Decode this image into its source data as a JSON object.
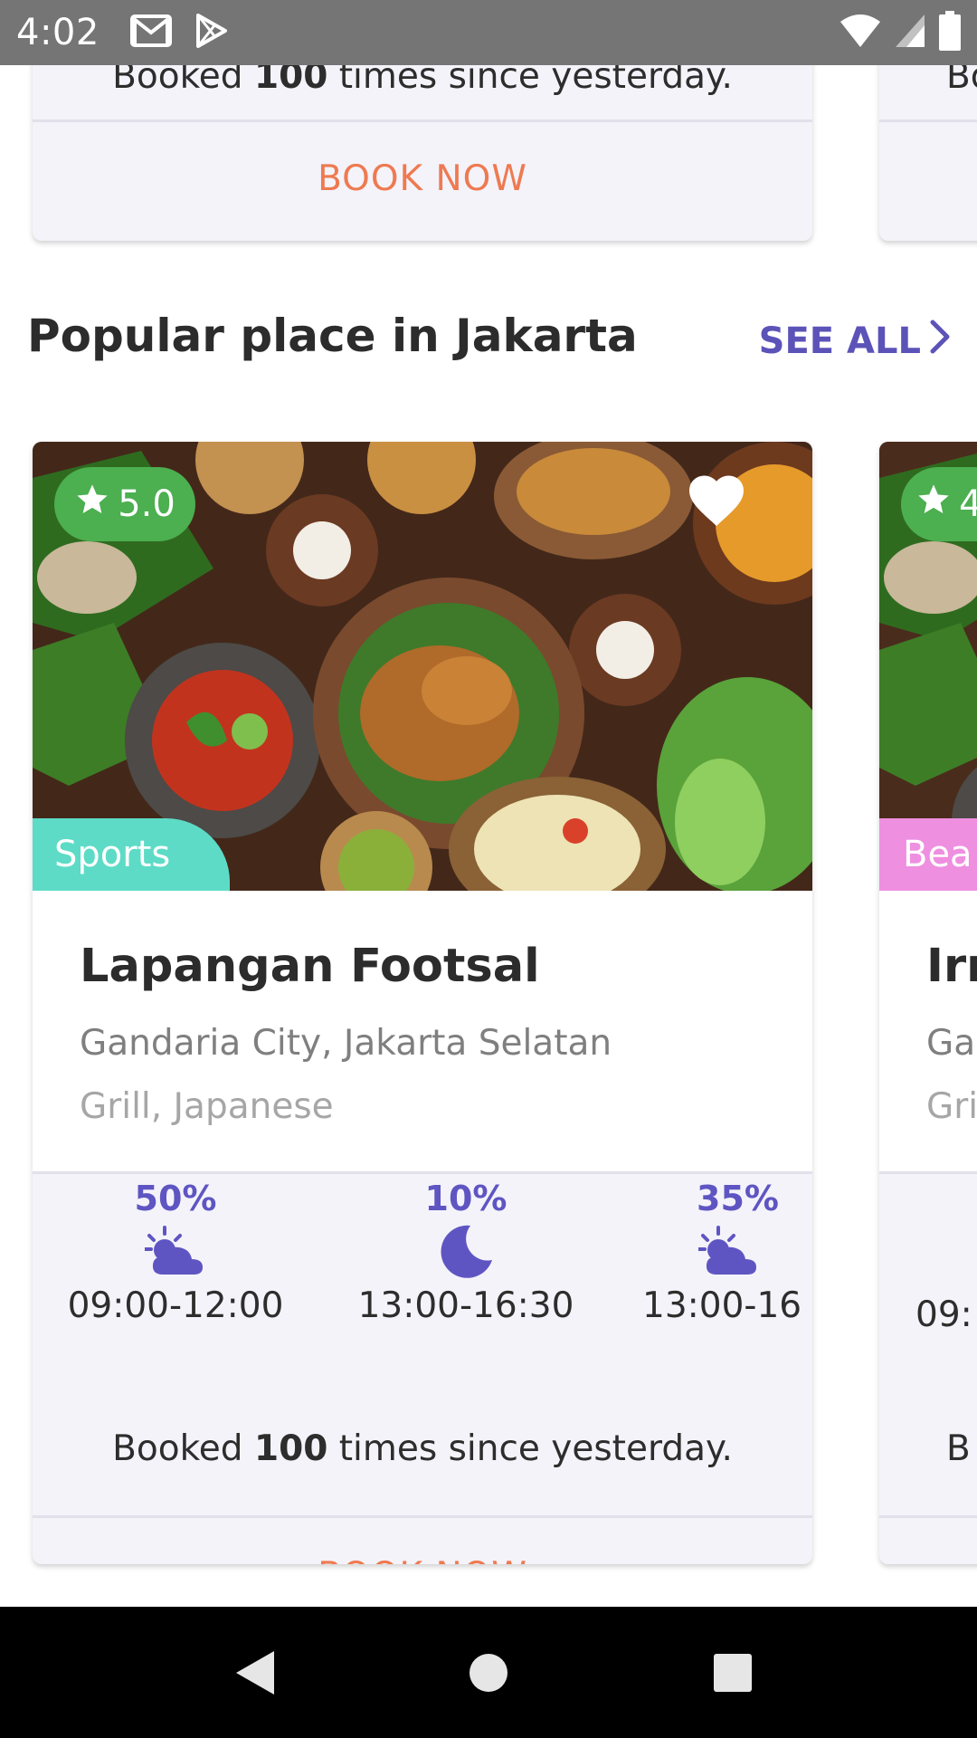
{
  "status_bar": {
    "time": "4:02"
  },
  "top_card": {
    "booked_prefix": "Booked ",
    "booked_count": "100",
    "booked_suffix": " times since yesterday.",
    "book_now": "BOOK NOW",
    "peek_text": "Bo"
  },
  "section": {
    "title": "Popular place in Jakarta",
    "see_all": "SEE ALL"
  },
  "place_card": {
    "rating": "5.0",
    "category": "Sports",
    "name": "Lapangan Footsal",
    "location": "Gandaria City, Jakarta Selatan",
    "cuisine": "Grill, Japanese",
    "slots": [
      {
        "percent": "50%",
        "icon": "partly-cloudy-icon",
        "time": "09:00-12:00"
      },
      {
        "percent": "10%",
        "icon": "moon-icon",
        "time": "13:00-16:30"
      },
      {
        "percent": "35%",
        "icon": "partly-cloudy-icon",
        "time": "13:00-16"
      }
    ],
    "booked_prefix": "Booked ",
    "booked_count": "100",
    "booked_suffix": " times since yesterday.",
    "book_now": "BOOK NOW"
  },
  "next_card": {
    "rating": "4",
    "category": "Bea",
    "name": "Irr",
    "location": "Ga",
    "cuisine": "Gri",
    "time": "09:",
    "booked": "B"
  },
  "colors": {
    "accent": "#5c53b8",
    "book_now": "#ee7a51",
    "rating_badge": "#4caf50",
    "sports_tag": "#5ddbc6",
    "beauty_tag": "#ef8fe0"
  }
}
